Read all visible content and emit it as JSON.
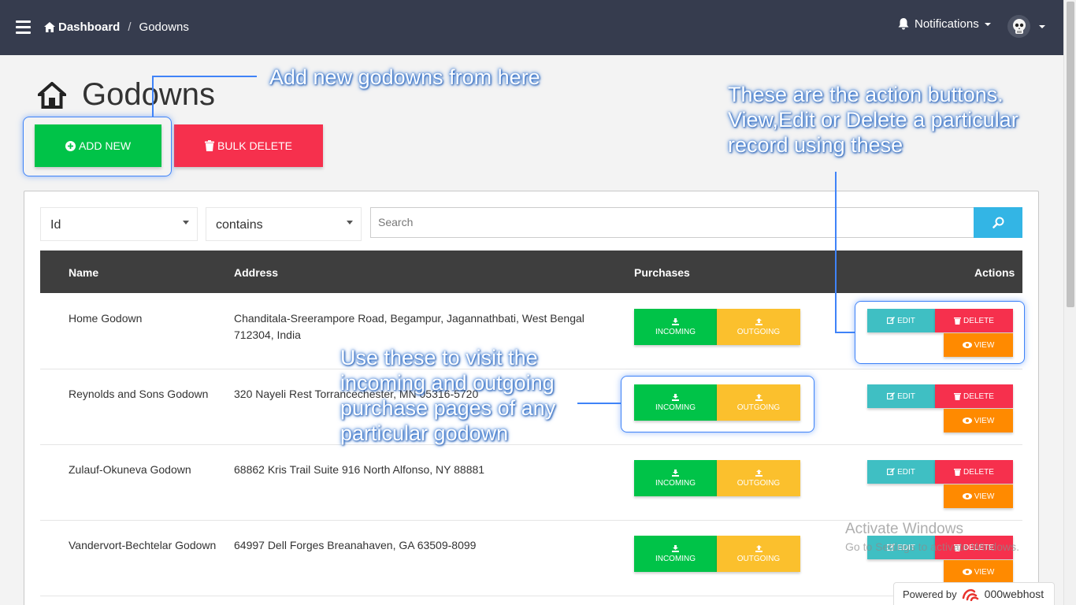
{
  "navbar": {
    "breadcrumb_home": "Dashboard",
    "breadcrumb_sep": "/",
    "breadcrumb_current": "Godowns",
    "notifications_label": "Notifications"
  },
  "page": {
    "title": "Godowns",
    "add_new_label": "ADD NEW",
    "bulk_delete_label": "BULK DELETE"
  },
  "filters": {
    "field_value": "Id",
    "operator_value": "contains",
    "search_placeholder": "Search"
  },
  "table": {
    "headers": {
      "name": "Name",
      "address": "Address",
      "purchases": "Purchases",
      "actions": "Actions"
    },
    "rows": [
      {
        "name": "Home Godown",
        "address": "Chanditala-Sreerampore Road, Begampur, Jagannathbati, West Bengal 712304, India"
      },
      {
        "name": "Reynolds and Sons Godown",
        "address": "320 Nayeli Rest Torrancechester, MN 05316-5720"
      },
      {
        "name": "Zulauf-Okuneva Godown",
        "address": "68862 Kris Trail Suite 916 North Alfonso, NY 88881"
      },
      {
        "name": "Vandervort-Bechtelar Godown",
        "address": "64997 Dell Forges Breanahaven, GA 63509-8099"
      }
    ],
    "incoming_label": "INCOMING",
    "outgoing_label": "OUTGOING",
    "edit_label": "EDIT",
    "delete_label": "DELETE",
    "view_label": "VIEW"
  },
  "annotations": {
    "add_new": "Add new godowns from here",
    "actions": [
      "These are the action buttons.",
      "View,Edit or Delete a particular",
      "record using these"
    ],
    "purchases": [
      "Use these to visit the",
      "incoming and outgoing",
      "purchase pages of any",
      "particular godown"
    ]
  },
  "watermark": {
    "line1": "Activate Windows",
    "line2": "Go to Settings to activate Windows."
  },
  "footer": {
    "powered_by": "Powered by",
    "brand": "000webhost"
  },
  "colors": {
    "navbar": "#363c4e",
    "success": "#00c348",
    "danger": "#f6304d",
    "warning": "#fbc02d",
    "info": "#3fbfc3",
    "orange": "#ff8a00",
    "search_button": "#33b5e5",
    "annotation": "#3f83f8"
  },
  "icons": [
    "hamburger-icon",
    "home-icon",
    "bell-icon",
    "skull-avatar-icon",
    "plus-circle-icon",
    "trash-icon",
    "search-icon",
    "download-icon",
    "upload-icon",
    "edit-icon",
    "eye-icon"
  ]
}
